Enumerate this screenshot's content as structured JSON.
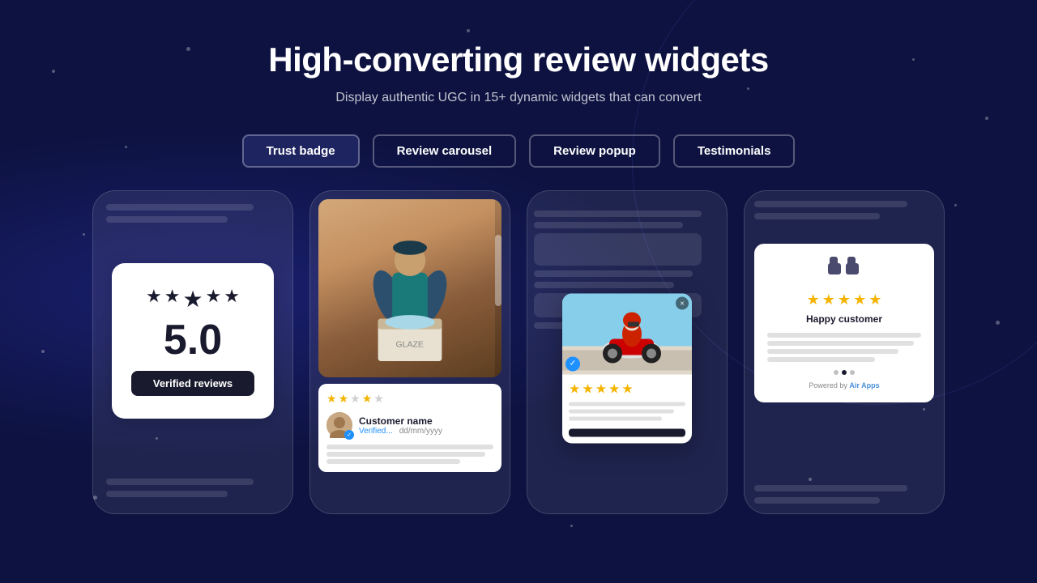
{
  "page": {
    "title": "High-converting review widgets",
    "subtitle": "Display authentic UGC in 15+ dynamic widgets that can convert"
  },
  "tabs": [
    {
      "id": "trust-badge",
      "label": "Trust badge",
      "active": true
    },
    {
      "id": "review-carousel",
      "label": "Review carousel",
      "active": false
    },
    {
      "id": "review-popup",
      "label": "Review popup",
      "active": false
    },
    {
      "id": "testimonials",
      "label": "Testimonials",
      "active": false
    }
  ],
  "widgets": {
    "trust_badge": {
      "rating": "5.0",
      "label": "Verified reviews"
    },
    "carousel": {
      "customer_name": "Customer name",
      "verified": "Verified...",
      "date": "dd/mm/yyyy"
    },
    "popup": {
      "close": "×"
    },
    "testimonials": {
      "label": "Happy customer",
      "powered_by": "Powered by ",
      "air_apps": "Air Apps"
    }
  }
}
